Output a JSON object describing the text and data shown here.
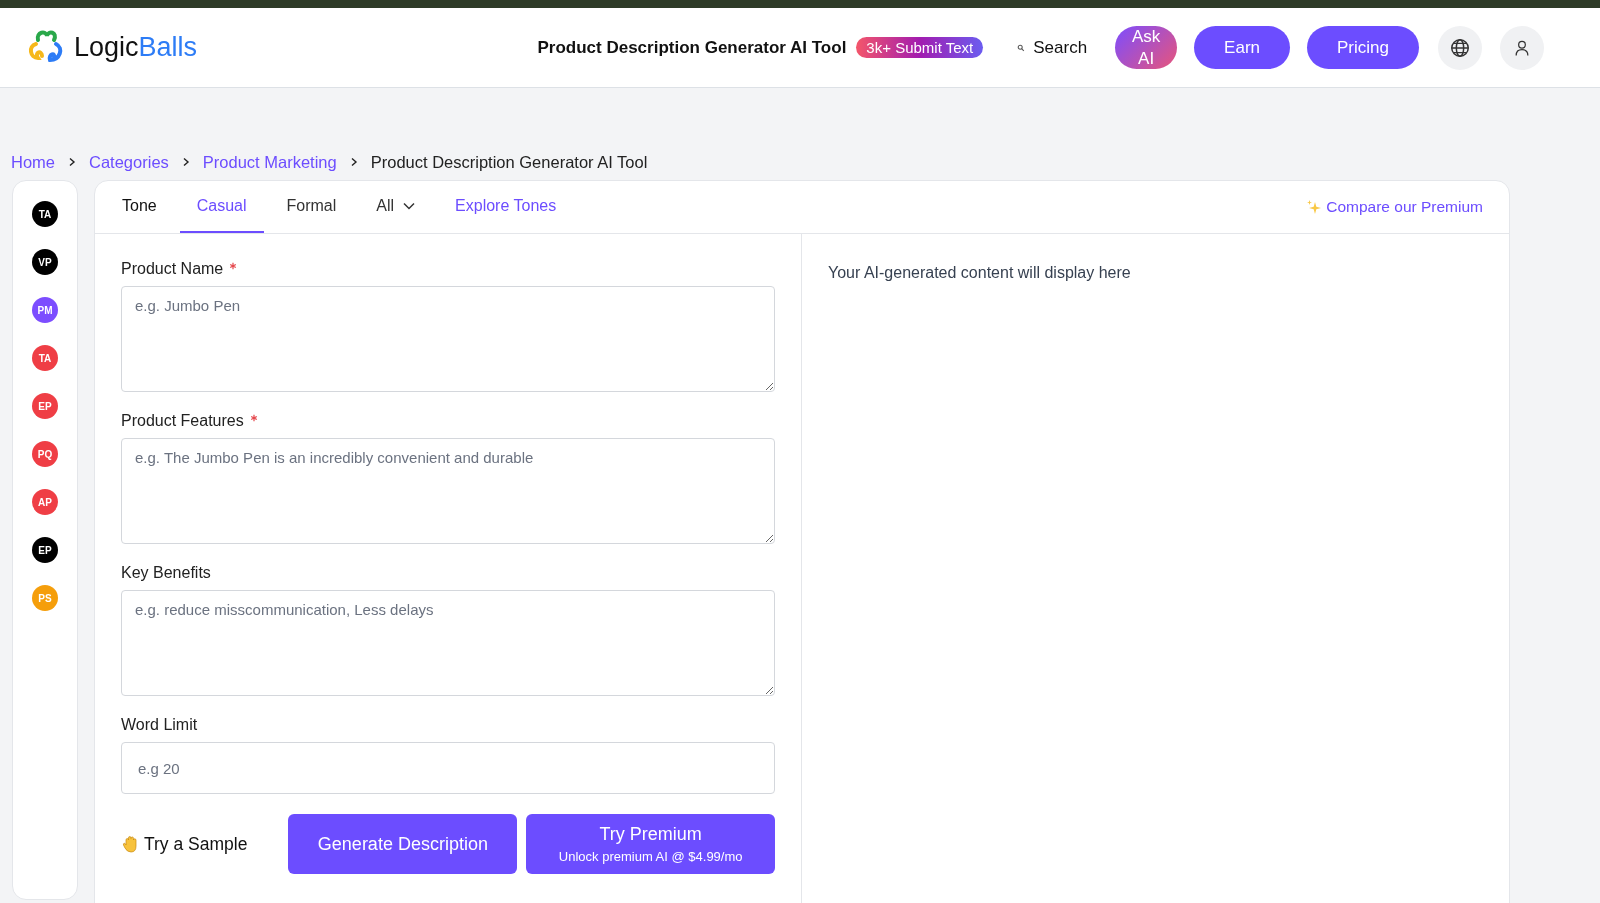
{
  "header": {
    "logo": {
      "text": "Logic",
      "accent": "Balls"
    },
    "page_title": "Product Description Generator AI Tool",
    "badge": "3k+ Submit Text",
    "search": "Search",
    "buttons": [
      {
        "label": "Ask AI",
        "kind": "gradient"
      },
      {
        "label": "Earn",
        "kind": "solid"
      },
      {
        "label": "Pricing",
        "kind": "solid"
      }
    ]
  },
  "breadcrumb": [
    {
      "label": "Home",
      "link": true
    },
    {
      "label": "Categories",
      "link": true
    },
    {
      "label": "Product Marketing",
      "link": true
    },
    {
      "label": "Product Description Generator AI Tool",
      "link": false
    }
  ],
  "sidebar": {
    "items": [
      {
        "initials": "TA",
        "color": "#000000"
      },
      {
        "initials": "VP",
        "color": "#000000"
      },
      {
        "initials": "PM",
        "color": "#7c4dff"
      },
      {
        "initials": "TA",
        "color": "#ef3e45"
      },
      {
        "initials": "EP",
        "color": "#ef3e45"
      },
      {
        "initials": "PQ",
        "color": "#ef3e45"
      },
      {
        "initials": "AP",
        "color": "#ef3e45"
      },
      {
        "initials": "EP",
        "color": "#000000"
      },
      {
        "initials": "PS",
        "color": "#f59e0b"
      }
    ]
  },
  "tone_label": "Tone",
  "tabs": [
    {
      "label": "Casual",
      "kind": "tab",
      "selected": true
    },
    {
      "label": "Formal",
      "kind": "tab",
      "selected": false
    },
    {
      "label": "All",
      "kind": "dropdown",
      "selected": false
    },
    {
      "label": "Explore Tones",
      "kind": "link",
      "selected": false
    }
  ],
  "premium_link": "Compare our Premium",
  "fields": [
    {
      "label": "Product Name",
      "required": true,
      "kind": "textarea",
      "placeholder": "e.g. Jumbo Pen"
    },
    {
      "label": "Product Features",
      "required": true,
      "kind": "textarea",
      "placeholder": "e.g. The Jumbo Pen is an incredibly convenient and durable"
    },
    {
      "label": "Key Benefits",
      "required": false,
      "kind": "textarea",
      "placeholder": "e.g. reduce misscommunication, Less delays"
    },
    {
      "label": "Word Limit",
      "required": false,
      "kind": "input",
      "placeholder": "e.g 20"
    }
  ],
  "sample": "Try a Sample",
  "generate_button": "Generate Description",
  "premium_button": {
    "title": "Try Premium",
    "subtitle": "Unlock premium AI @ $4.99/mo"
  },
  "output_placeholder": "Your AI-generated content will display here"
}
